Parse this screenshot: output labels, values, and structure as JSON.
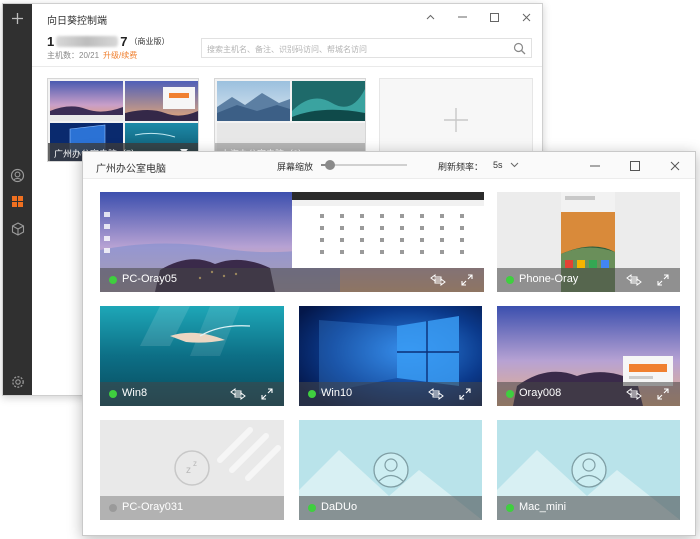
{
  "back_window": {
    "title": "向日葵控制端",
    "account": {
      "number_start": "1",
      "number_end": "7",
      "edition": "（商业版）",
      "host_count": "主机数：20/21",
      "upgrade_link": "升级/续费"
    },
    "search": {
      "placeholder": "搜索主机名、备注、识别码访问、帮城名访问"
    },
    "groups": [
      {
        "label": "广州办公室电脑（7）",
        "selected": true
      },
      {
        "label": "上海办公室电脑（2）",
        "selected": false
      }
    ],
    "sidebar_icons": [
      "plus-icon",
      "remote-control-icon",
      "host-list-icon",
      "cube-icon",
      "settings-icon"
    ]
  },
  "front_window": {
    "title": "广州办公室电脑",
    "zoom_label": "屏幕缩放",
    "zoom_level": 0.1,
    "refresh_label": "刷新频率：",
    "refresh_value": "5s",
    "tiles": [
      {
        "name": "PC-Oray05",
        "online": true
      },
      {
        "name": "Phone-Oray",
        "online": true
      },
      {
        "name": "Win8",
        "online": true
      },
      {
        "name": "Win10",
        "online": true
      },
      {
        "name": "Oray008",
        "online": true
      },
      {
        "name": "PC-Oray031",
        "online": false
      },
      {
        "name": "DaDUo",
        "online": true
      },
      {
        "name": "Mac_mini",
        "online": true
      }
    ]
  },
  "colors": {
    "online": "#3fcf3f",
    "offline": "#9a9a9a",
    "upgrade": "#f08030",
    "sidebar": "#303030"
  }
}
